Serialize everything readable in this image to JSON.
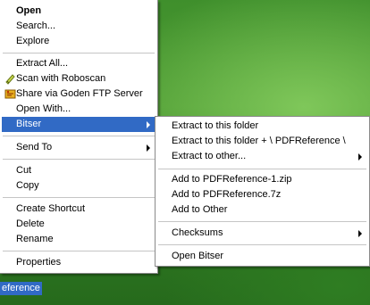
{
  "desktop": {
    "label": "eference"
  },
  "main_menu": {
    "open": "Open",
    "search": "Search...",
    "explore": "Explore",
    "extract_all": "Extract All...",
    "scan": "Scan with Roboscan",
    "share_ftp": "Share via Goden FTP Server",
    "open_with": "Open With...",
    "bitser": "Bitser",
    "send_to": "Send To",
    "cut": "Cut",
    "copy": "Copy",
    "create_shortcut": "Create Shortcut",
    "delete": "Delete",
    "rename": "Rename",
    "properties": "Properties"
  },
  "bitser_menu": {
    "extract_here": "Extract to this folder",
    "extract_to_folder": "Extract to this folder + \\ PDFReference \\",
    "extract_other": "Extract to other...",
    "add_zip": "Add to PDFReference-1.zip",
    "add_7z": "Add to PDFReference.7z",
    "add_other": "Add to Other",
    "checksums": "Checksums",
    "open_bitser": "Open Bitser"
  },
  "icons": {
    "scan": "roboscan-shield-icon",
    "share_ftp": "ftp-server-icon"
  },
  "colors": {
    "highlight": "#316ac5",
    "separator": "#c5c5c5"
  }
}
